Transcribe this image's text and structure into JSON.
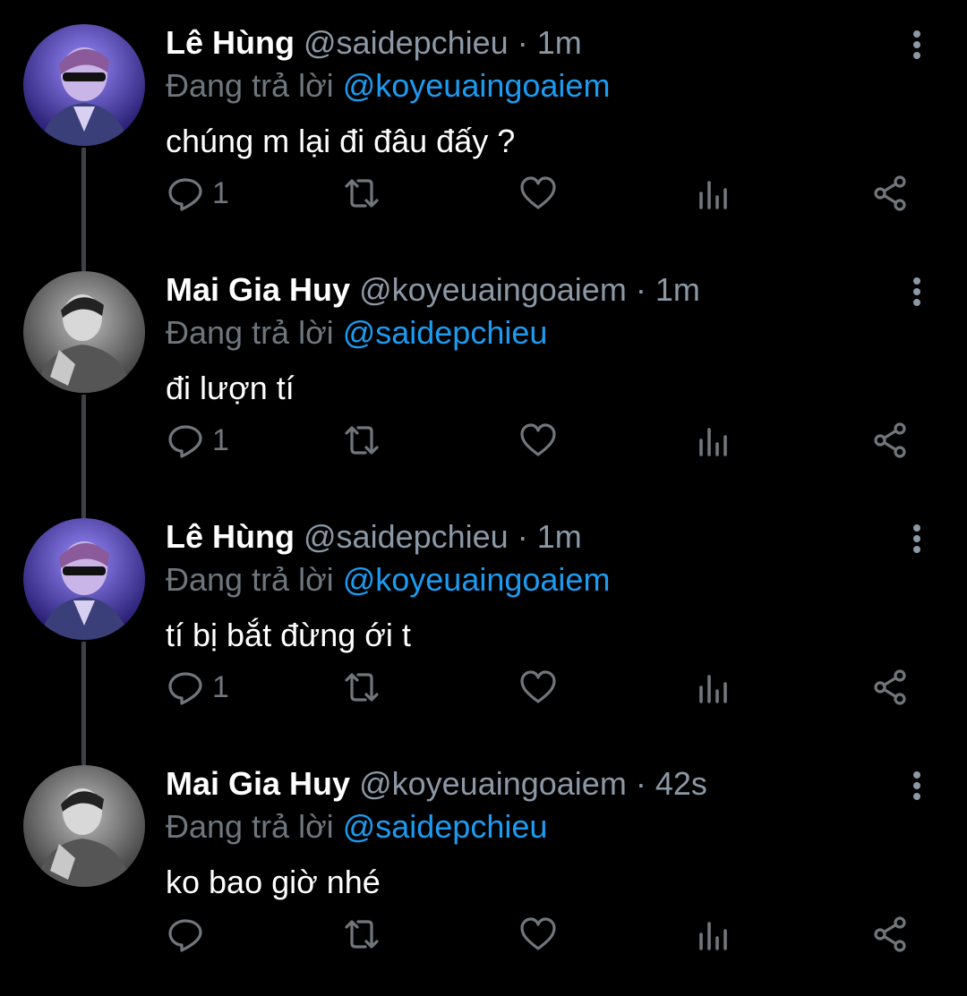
{
  "tweets": [
    {
      "name": "Lê Hùng",
      "handle": "@saidepchieu",
      "separator": "·",
      "time": "1m",
      "reply_prefix": "Đang trả lời",
      "reply_to": "@koyeuaingoaiem",
      "text": "chúng m lại đi đâu đấy ?",
      "reply_count": "1",
      "avatar": "avatar-purple-sunglasses"
    },
    {
      "name": "Mai Gia Huy",
      "handle": "@koyeuaingoaiem",
      "separator": "·",
      "time": "1m",
      "reply_prefix": "Đang trả lời",
      "reply_to": "@saidepchieu",
      "text": "đi lượn tí",
      "reply_count": "1",
      "avatar": "avatar-grayscale"
    },
    {
      "name": "Lê Hùng",
      "handle": "@saidepchieu",
      "separator": "·",
      "time": "1m",
      "reply_prefix": "Đang trả lời",
      "reply_to": "@koyeuaingoaiem",
      "text": "tí bị bắt đừng ới t",
      "reply_count": "1",
      "avatar": "avatar-purple-sunglasses"
    },
    {
      "name": "Mai Gia Huy",
      "handle": "@koyeuaingoaiem",
      "separator": "·",
      "time": "42s",
      "reply_prefix": "Đang trả lời",
      "reply_to": "@saidepchieu",
      "text": "ko bao giờ nhé",
      "reply_count": "",
      "avatar": "avatar-grayscale"
    }
  ],
  "icons": {
    "reply": "reply-icon",
    "retweet": "retweet-icon",
    "like": "heart-icon",
    "views": "views-icon",
    "share": "share-icon",
    "more": "more-vertical-icon"
  },
  "colors": {
    "background": "#000000",
    "name": "#ffffff",
    "secondary": "#8b98a5",
    "mention": "#1d9bf0",
    "icon": "#71767b",
    "thread_line": "#3e4144"
  }
}
